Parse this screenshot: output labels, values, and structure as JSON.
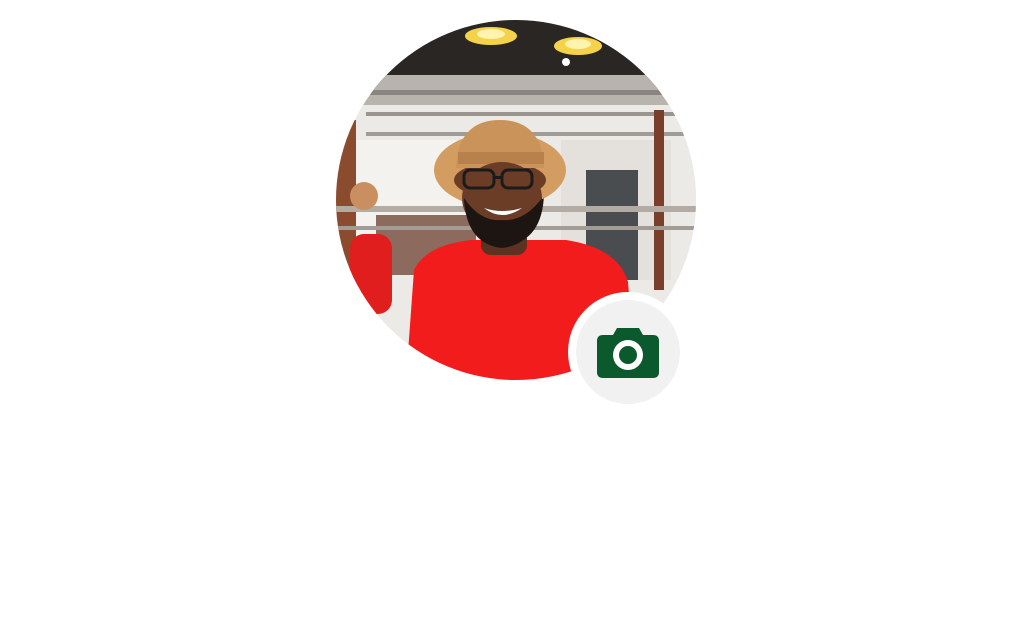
{
  "profile": {
    "photo_subject": "avatar",
    "accent_color": "#0b5a2e",
    "camera_icon": "camera-icon"
  }
}
